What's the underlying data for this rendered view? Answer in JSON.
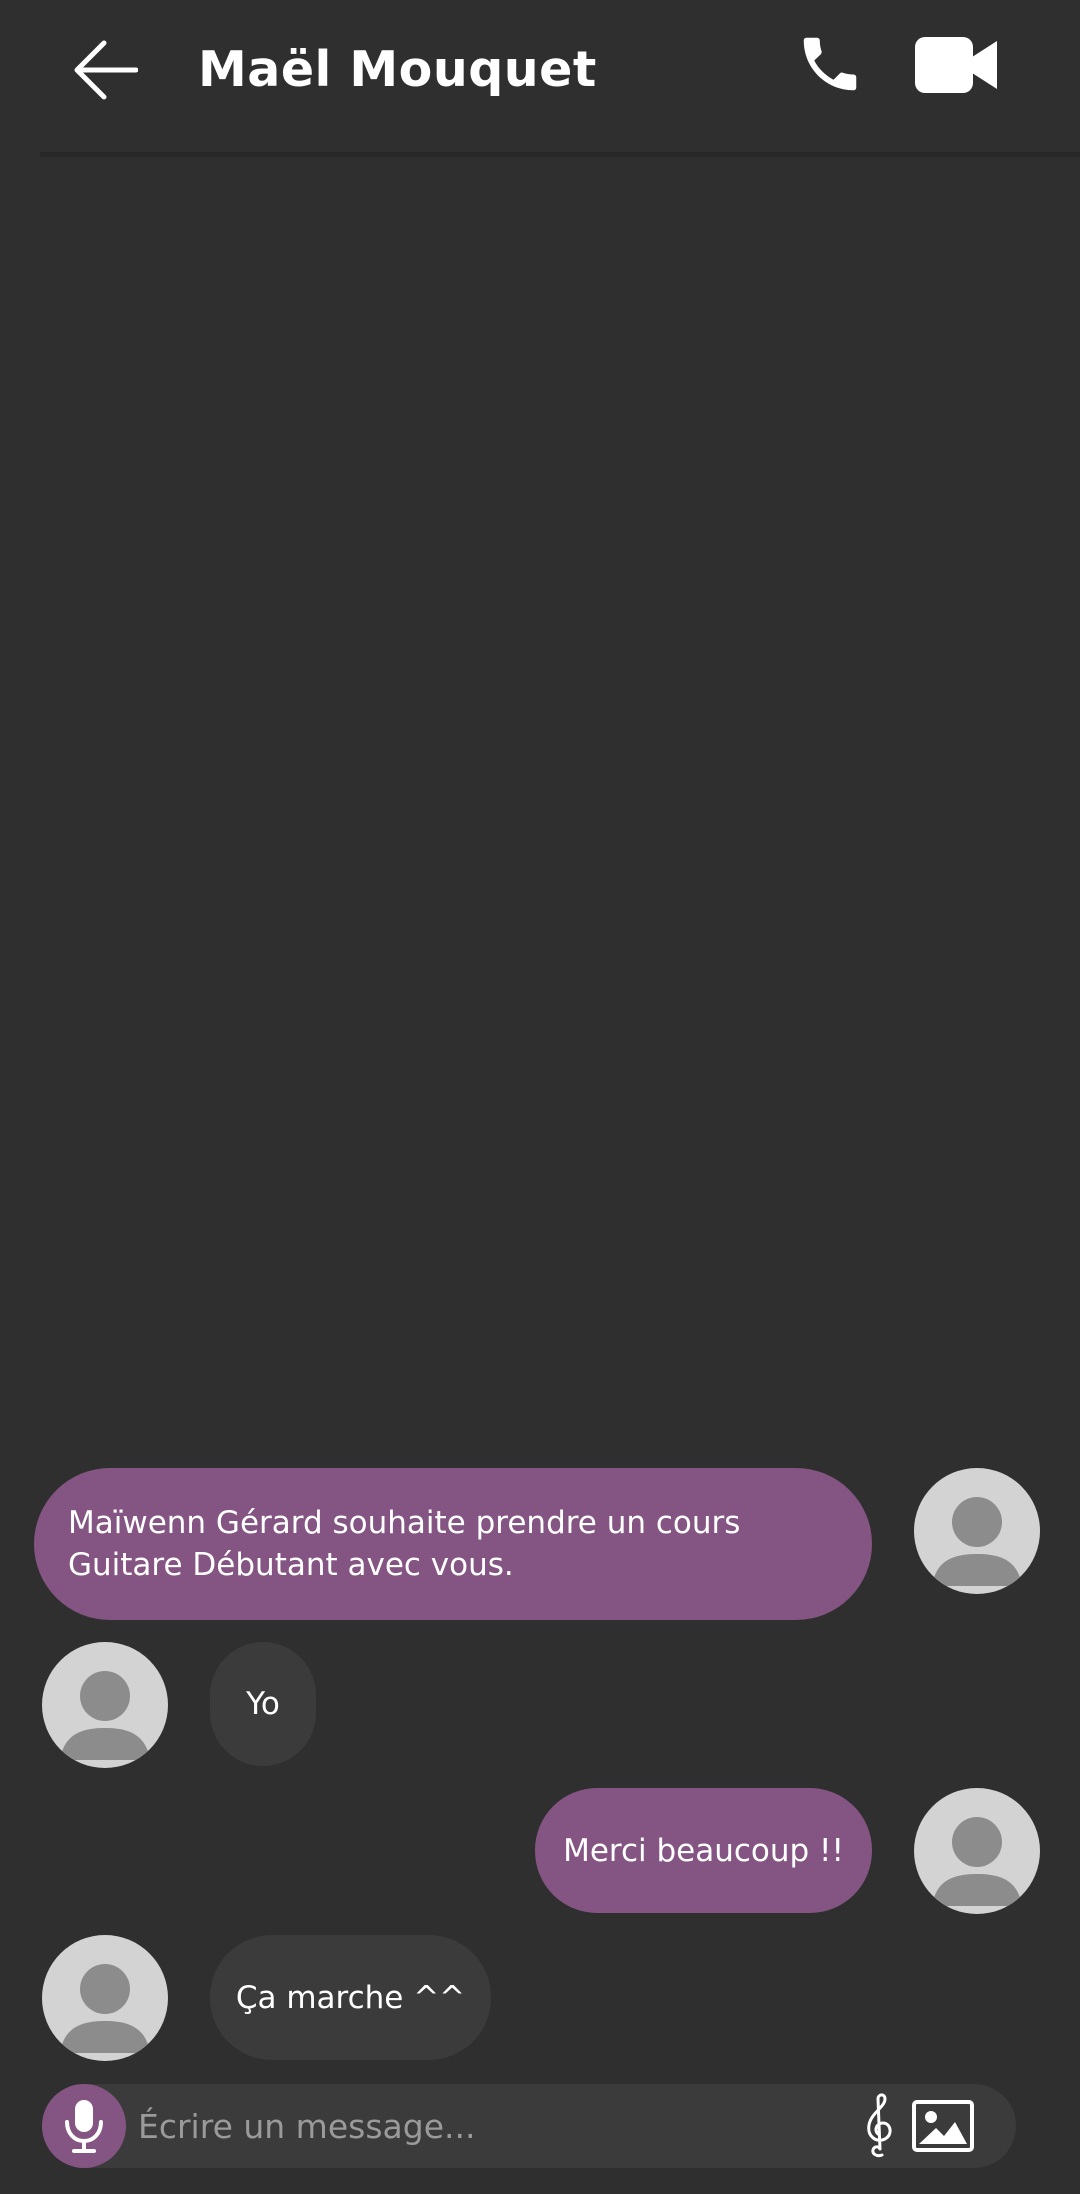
{
  "header": {
    "contact_name": "Maël Mouquet",
    "back_icon": "arrow-left-icon",
    "call_icon": "phone-icon",
    "video_icon": "video-camera-icon"
  },
  "messages": [
    {
      "direction": "sent",
      "text": "Maïwenn Gérard souhaite prendre un cours Guitare Débutant avec vous."
    },
    {
      "direction": "received",
      "text": "Yo"
    },
    {
      "direction": "sent",
      "text": "Merci beaucoup !!"
    },
    {
      "direction": "received",
      "text": "Ça marche ^^"
    }
  ],
  "composer": {
    "placeholder": "Écrire un message...",
    "value": "",
    "mic_icon": "microphone-icon",
    "music_icon": "treble-clef-icon",
    "image_icon": "image-icon"
  },
  "colors": {
    "background": "#2f2f2f",
    "accent": "#845582",
    "received_bubble": "#3b3b3b",
    "avatar": "#d3d3d3"
  }
}
